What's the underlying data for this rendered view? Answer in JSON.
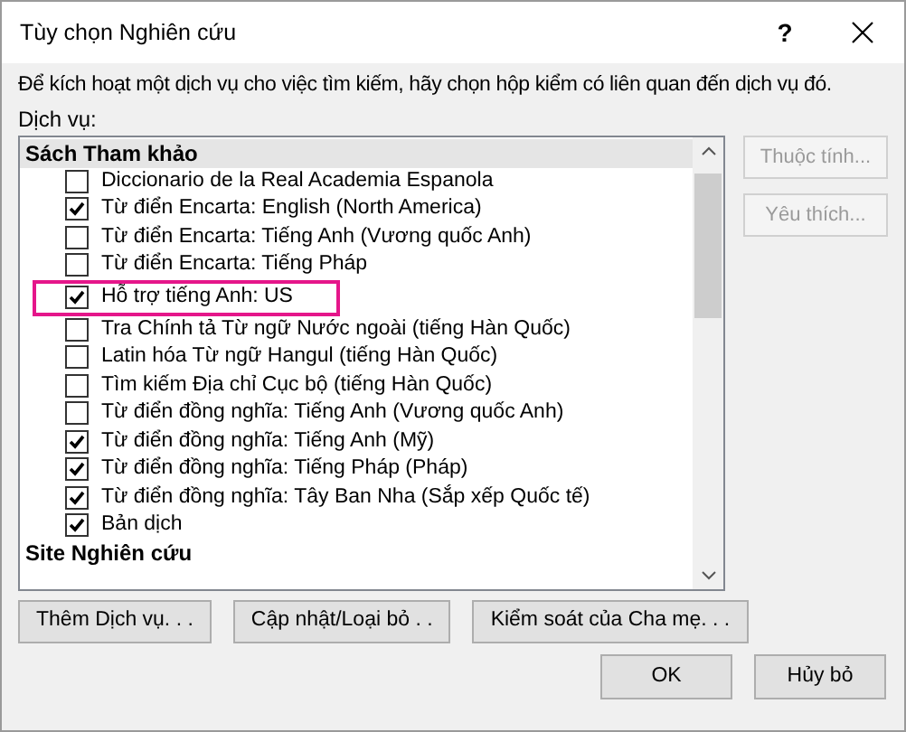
{
  "window": {
    "title": "Tùy chọn Nghiên cứu",
    "help": "?"
  },
  "instruction": "Để kích hoạt một dịch vụ cho việc tìm kiếm, hãy chọn hộp kiểm có liên quan đến dịch vụ đó.",
  "services_label": "Dịch vụ:",
  "services": [
    {
      "kind": "group",
      "label": "Sách Tham khảo",
      "selected": true
    },
    {
      "kind": "item",
      "label": "Diccionario de la Real Academia Espanola",
      "checked": false,
      "highlighted": false
    },
    {
      "kind": "item",
      "label": "Từ điển Encarta: English (North America)",
      "checked": true,
      "highlighted": false
    },
    {
      "kind": "item",
      "label": "Từ điển Encarta: Tiếng Anh (Vương quốc Anh)",
      "checked": false,
      "highlighted": false
    },
    {
      "kind": "item",
      "label": "Từ điển Encarta: Tiếng Pháp",
      "checked": false,
      "highlighted": false
    },
    {
      "kind": "item",
      "label": "Hỗ trợ tiếng Anh: US",
      "checked": true,
      "highlighted": true
    },
    {
      "kind": "item",
      "label": "Tra Chính tả Từ ngữ Nước ngoài (tiếng Hàn Quốc)",
      "checked": false,
      "highlighted": false
    },
    {
      "kind": "item",
      "label": "Latin hóa Từ ngữ Hangul (tiếng Hàn Quốc)",
      "checked": false,
      "highlighted": false
    },
    {
      "kind": "item",
      "label": "Tìm kiếm Địa chỉ Cục bộ (tiếng Hàn Quốc)",
      "checked": false,
      "highlighted": false
    },
    {
      "kind": "item",
      "label": "Từ điển đồng nghĩa: Tiếng Anh (Vương quốc Anh)",
      "checked": false,
      "highlighted": false
    },
    {
      "kind": "item",
      "label": "Từ điển đồng nghĩa: Tiếng Anh (Mỹ)",
      "checked": true,
      "highlighted": false
    },
    {
      "kind": "item",
      "label": "Từ điển đồng nghĩa: Tiếng Pháp (Pháp)",
      "checked": true,
      "highlighted": false
    },
    {
      "kind": "item",
      "label": "Từ điển đồng nghĩa: Tây Ban Nha (Sắp xếp Quốc tế)",
      "checked": true,
      "highlighted": false
    },
    {
      "kind": "item",
      "label": "Bản dịch",
      "checked": true,
      "highlighted": false
    },
    {
      "kind": "group",
      "label": "Site Nghiên cứu",
      "selected": false
    }
  ],
  "side_buttons": [
    {
      "label": "Thuộc tính...",
      "disabled": true
    },
    {
      "label": "Yêu thích...",
      "disabled": true
    }
  ],
  "service_buttons": [
    "Thêm Dịch vụ. . .",
    "Cập nhật/Loại bỏ . .",
    "Kiểm soát của Cha mẹ. . ."
  ],
  "dialog_buttons": [
    "OK",
    "Hủy bỏ"
  ]
}
